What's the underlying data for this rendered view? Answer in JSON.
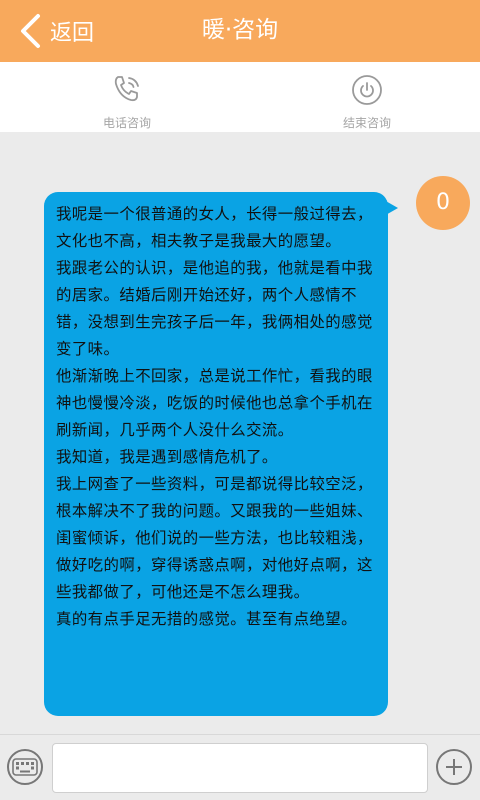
{
  "header": {
    "back_label": "返回",
    "title": "暖·咨询",
    "color": "#f8a95c"
  },
  "actions": {
    "phone": {
      "icon": "phone-icon",
      "label": "电话咨询"
    },
    "end": {
      "icon": "power-icon",
      "label": "结束咨询"
    }
  },
  "message": {
    "avatar_text": "0",
    "bubble_color": "#0aa3e4",
    "paragraphs": [
      "我呢是一个很普通的女人，长得一般过得去，文化也不高，相夫教子是我最大的愿望。",
      "我跟老公的认识，是他追的我，他就是看中我的居家。结婚后刚开始还好，两个人感情不错，没想到生完孩子后一年，我俩相处的感觉变了味。",
      "他渐渐晚上不回家，总是说工作忙，看我的眼神也慢慢冷淡，吃饭的时候他也总拿个手机在刷新闻，几乎两个人没什么交流。",
      "我知道，我是遇到感情危机了。",
      "我上网查了一些资料，可是都说得比较空泛，根本解决不了我的问题。又跟我的一些姐妹、闺蜜倾诉，他们说的一些方法，也比较粗浅，做好吃的啊，穿得诱惑点啊，对他好点啊，这些我都做了，可他还是不怎么理我。",
      "真的有点手足无措的感觉。甚至有点绝望。"
    ]
  },
  "input_bar": {
    "keyboard_icon": "keyboard-icon",
    "input_value": "",
    "input_placeholder": "",
    "plus_icon": "plus-icon"
  }
}
